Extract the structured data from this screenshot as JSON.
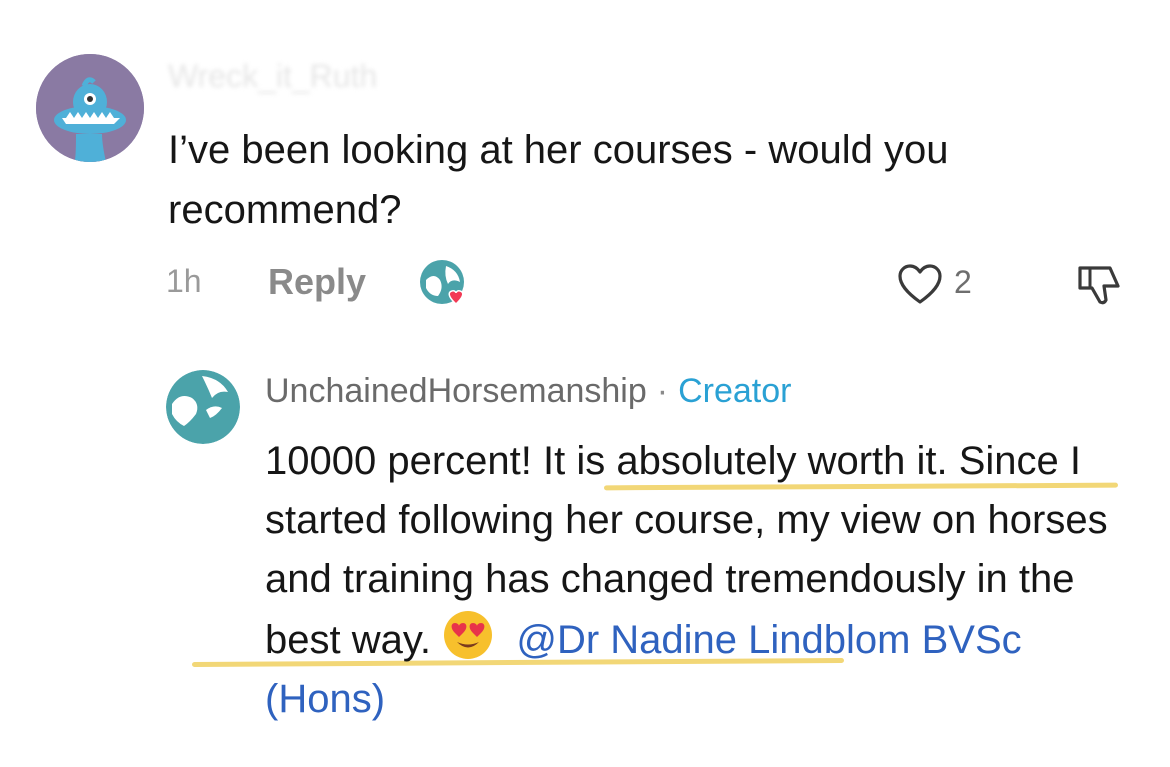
{
  "top_comment": {
    "username": "Wreck_it_Ruth",
    "text": "I’ve been looking at her courses - would you recommend?",
    "time": "1h",
    "reply_label": "Reply",
    "like_count": "2"
  },
  "reply_comment": {
    "username": "UnchainedHorsemanship",
    "separator": "·",
    "badge": "Creator",
    "text_part1": "10000 percent! ",
    "text_highlight1": "It is absolutely worth it.",
    "text_part2": " Since I started following her course, my view on horses and training has changed ",
    "text_highlight2": "tremendously in the best way.",
    "text_part3": " ",
    "mention": "@Dr Nadine Lindblom BVSc (Hons)"
  },
  "colors": {
    "avatar_purple": "#8a7aa3",
    "teal": "#4ba3aa",
    "creator_blue": "#2aa1d4",
    "mention_blue": "#2f62bf",
    "highlight_yellow": "#f2d777",
    "heart_red": "#f23a55"
  },
  "icons": {
    "top_avatar": "blue-monster-icon",
    "reply_avatar": "horse-logo-icon",
    "creator_liked": "creator-heart-icon",
    "like": "heart-outline-icon",
    "dislike": "thumbs-down-icon",
    "emoji": "heart-eyes-emoji-icon"
  }
}
